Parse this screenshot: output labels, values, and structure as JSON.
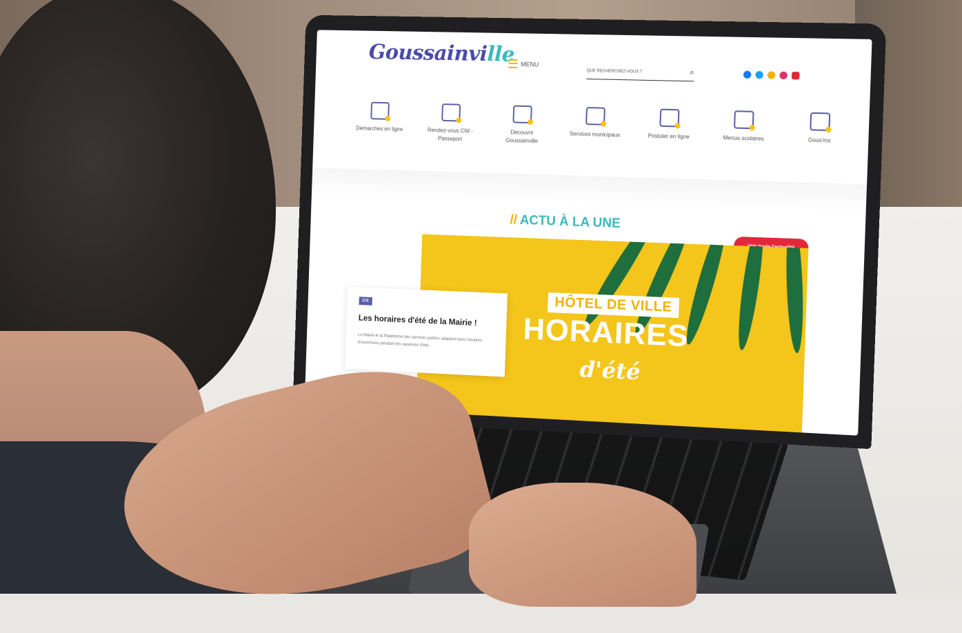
{
  "site": {
    "logo_main": "Goussainvi",
    "logo_accent": "lle",
    "menu_label": "MENU",
    "search_placeholder": "QUE RECHERCHEZ-VOUS ?",
    "social_colors": [
      "#1877f2",
      "#1da1f2",
      "#f2b200",
      "#e1306c",
      "#e3283a"
    ]
  },
  "services": [
    {
      "label": "Démarches en ligne",
      "icon": "document-icon"
    },
    {
      "label": "Rendez-vous CNI - Passeport",
      "icon": "appointment-icon"
    },
    {
      "label": "Découvrir Goussainville",
      "icon": "landmark-icon"
    },
    {
      "label": "Services municipaux",
      "icon": "book-icon"
    },
    {
      "label": "Postuler en ligne",
      "icon": "briefcase-icon"
    },
    {
      "label": "Menus scolaires",
      "icon": "plate-icon"
    },
    {
      "label": "Gous'ms",
      "icon": "sms-phone-icon"
    }
  ],
  "actu": {
    "title": "ACTU À LA UNE",
    "button_label": "Voir toute l'actualité"
  },
  "hero": {
    "tag": "HÔTEL DE VILLE",
    "big": "HORAIRES",
    "script": "d'été"
  },
  "news_card": {
    "badge": "ÉTÉ",
    "title": "Les horaires d'été de la Mairie !",
    "description": "La Mairie et la Plateforme des services publics adaptent leurs horaires d'ouvertures pendant les vacances d'été."
  },
  "colors": {
    "brand_purple": "#5b5fa6",
    "brand_teal": "#3ab9b9",
    "accent_yellow": "#f4c51b",
    "button_red": "#e3283a"
  }
}
